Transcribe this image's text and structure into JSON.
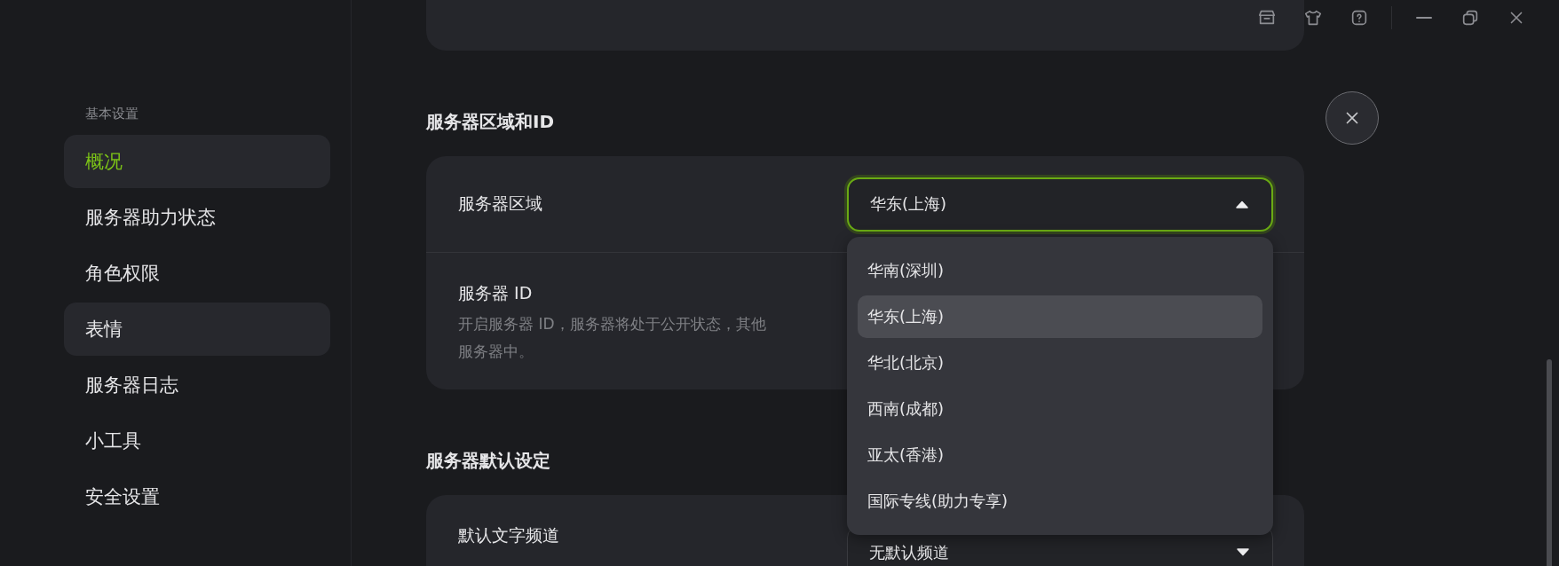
{
  "sidebar": {
    "sections": [
      {
        "label": "基本设置",
        "items": [
          {
            "label": "概况",
            "selected": true,
            "hovered": false
          },
          {
            "label": "服务器助力状态",
            "selected": false,
            "hovered": false
          },
          {
            "label": "角色权限",
            "selected": false,
            "hovered": false
          },
          {
            "label": "表情",
            "selected": false,
            "hovered": true
          },
          {
            "label": "服务器日志",
            "selected": false,
            "hovered": false
          },
          {
            "label": "小工具",
            "selected": false,
            "hovered": false
          },
          {
            "label": "安全设置",
            "selected": false,
            "hovered": false
          }
        ]
      }
    ]
  },
  "sections": [
    {
      "title": "服务器区域和ID",
      "rows": [
        {
          "kind": "select",
          "label": "服务器区域",
          "value": "华东(上海)",
          "expanded": true,
          "options": [
            {
              "label": "华南(深圳)",
              "selected": false
            },
            {
              "label": "华东(上海)",
              "selected": true
            },
            {
              "label": "华北(北京)",
              "selected": false
            },
            {
              "label": "西南(成都)",
              "selected": false
            },
            {
              "label": "亚太(香港)",
              "selected": false
            },
            {
              "label": "国际专线(助力专享)",
              "selected": false
            }
          ]
        },
        {
          "kind": "text",
          "label": "服务器 ID",
          "description": [
            "开启服务器 ID，服务器将处于公开状态，其他",
            "服务器中。"
          ]
        }
      ]
    },
    {
      "title": "服务器默认设定",
      "rows": [
        {
          "kind": "select",
          "label": "默认文字频道",
          "value": "无默认频道",
          "expanded": false
        }
      ]
    }
  ]
}
